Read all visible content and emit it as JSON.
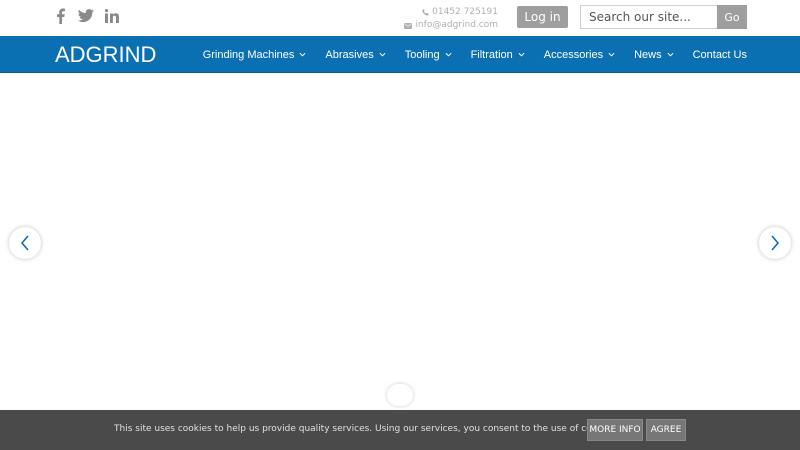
{
  "colors": {
    "brand": "#0a70b2",
    "cookie_bg": "#4a4a4a",
    "button_grey": "#9e9e9e"
  },
  "social": [
    {
      "icon": "facebook-icon"
    },
    {
      "icon": "twitter-icon"
    },
    {
      "icon": "linkedin-icon"
    }
  ],
  "contact": {
    "phone": "01452 725191",
    "email": "info@adgrind.com"
  },
  "header": {
    "login_label": "Log in",
    "search_placeholder": "Search our site...",
    "search_button": "Go"
  },
  "logo": {
    "text": "ADGRIND"
  },
  "nav": {
    "items": [
      {
        "label": "Grinding Machines",
        "dropdown": true
      },
      {
        "label": "Abrasives",
        "dropdown": true
      },
      {
        "label": "Tooling",
        "dropdown": true
      },
      {
        "label": "Filtration",
        "dropdown": true
      },
      {
        "label": "Accessories",
        "dropdown": true
      },
      {
        "label": "News",
        "dropdown": true
      },
      {
        "label": "Contact Us",
        "dropdown": false
      }
    ]
  },
  "cookie": {
    "message": "This site uses cookies to help us provide quality services. Using our services, you consent to the use of cookies.",
    "more_info": "MORE INFO",
    "agree": "AGREE"
  }
}
